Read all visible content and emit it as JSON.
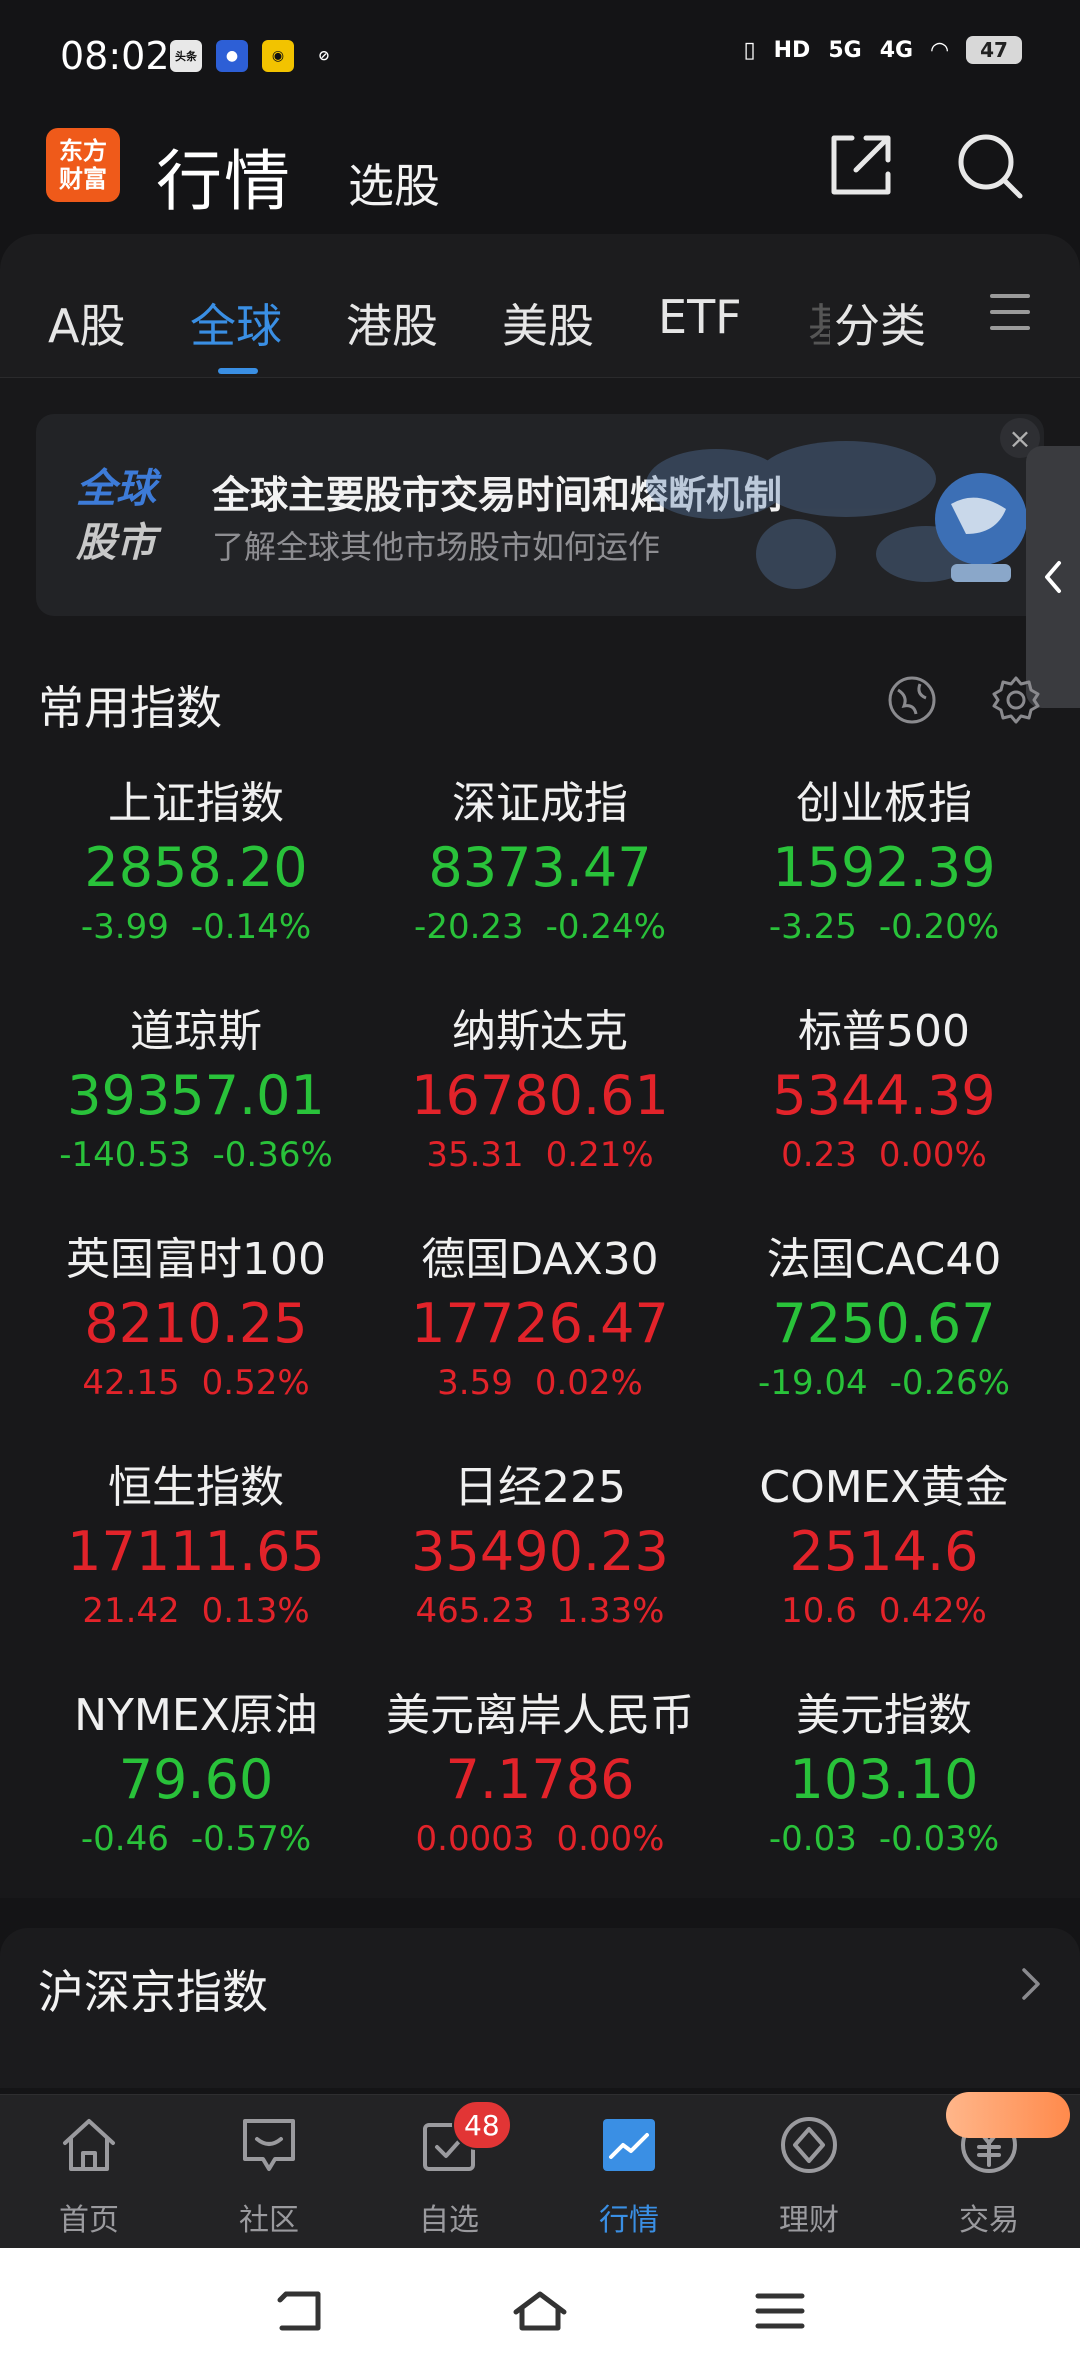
{
  "status_bar": {
    "time": "08:02",
    "app_icons": [
      "头条",
      "app",
      "微博",
      "link"
    ],
    "hd": "HD",
    "net1": "5G",
    "net2": "4G",
    "battery": "47"
  },
  "header": {
    "logo_line1": "东方",
    "logo_line2": "财富",
    "title": "行情",
    "subtitle": "选股",
    "icons": [
      "share-icon",
      "search-icon"
    ]
  },
  "tabs": [
    {
      "label": "A股",
      "active": false
    },
    {
      "label": "全球",
      "active": true
    },
    {
      "label": "港股",
      "active": false
    },
    {
      "label": "美股",
      "active": false
    },
    {
      "label": "ETF",
      "active": false
    },
    {
      "label": "基",
      "active": false
    },
    {
      "label": "分类",
      "active": false
    }
  ],
  "banner": {
    "logo_line1": "全球",
    "logo_line2": "股市",
    "title": "全球主要股市交易时间和熔断机制",
    "subtitle": "了解全球其他市场股市如何运作",
    "close": "×"
  },
  "section": {
    "title": "常用指数"
  },
  "indices": [
    {
      "name": "上证指数",
      "price": "2858.20",
      "change": "-3.99",
      "pct": "-0.14%",
      "dir": "down"
    },
    {
      "name": "深证成指",
      "price": "8373.47",
      "change": "-20.23",
      "pct": "-0.24%",
      "dir": "down"
    },
    {
      "name": "创业板指",
      "price": "1592.39",
      "change": "-3.25",
      "pct": "-0.20%",
      "dir": "down"
    },
    {
      "name": "道琼斯",
      "price": "39357.01",
      "change": "-140.53",
      "pct": "-0.36%",
      "dir": "down"
    },
    {
      "name": "纳斯达克",
      "price": "16780.61",
      "change": "35.31",
      "pct": "0.21%",
      "dir": "up"
    },
    {
      "name": "标普500",
      "price": "5344.39",
      "change": "0.23",
      "pct": "0.00%",
      "dir": "up"
    },
    {
      "name": "英国富时100",
      "price": "8210.25",
      "change": "42.15",
      "pct": "0.52%",
      "dir": "up"
    },
    {
      "name": "德国DAX30",
      "price": "17726.47",
      "change": "3.59",
      "pct": "0.02%",
      "dir": "up"
    },
    {
      "name": "法国CAC40",
      "price": "7250.67",
      "change": "-19.04",
      "pct": "-0.26%",
      "dir": "down"
    },
    {
      "name": "恒生指数",
      "price": "17111.65",
      "change": "21.42",
      "pct": "0.13%",
      "dir": "up"
    },
    {
      "name": "日经225",
      "price": "35490.23",
      "change": "465.23",
      "pct": "1.33%",
      "dir": "up"
    },
    {
      "name": "COMEX黄金",
      "price": "2514.6",
      "change": "10.6",
      "pct": "0.42%",
      "dir": "up"
    },
    {
      "name": "NYMEX原油",
      "price": "79.60",
      "change": "-0.46",
      "pct": "-0.57%",
      "dir": "down"
    },
    {
      "name": "美元离岸人民币",
      "price": "7.1786",
      "change": "0.0003",
      "pct": "0.00%",
      "dir": "up"
    },
    {
      "name": "美元指数",
      "price": "103.10",
      "change": "-0.03",
      "pct": "-0.03%",
      "dir": "down"
    }
  ],
  "colors": {
    "up": "#e2232a",
    "down": "#29c23a",
    "accent": "#3a8fe4",
    "logo": "#ef5a1a"
  },
  "card2": {
    "title": "沪深京指数"
  },
  "bottom_nav": [
    {
      "label": "首页",
      "icon": "home-icon",
      "active": false
    },
    {
      "label": "社区",
      "icon": "community-icon",
      "active": false
    },
    {
      "label": "自选",
      "icon": "watchlist-icon",
      "active": false
    },
    {
      "label": "行情",
      "icon": "market-icon",
      "active": true
    },
    {
      "label": "理财",
      "icon": "wealth-icon",
      "active": false
    },
    {
      "label": "交易",
      "icon": "trade-icon",
      "active": false
    }
  ],
  "watchlist_badge": "48"
}
